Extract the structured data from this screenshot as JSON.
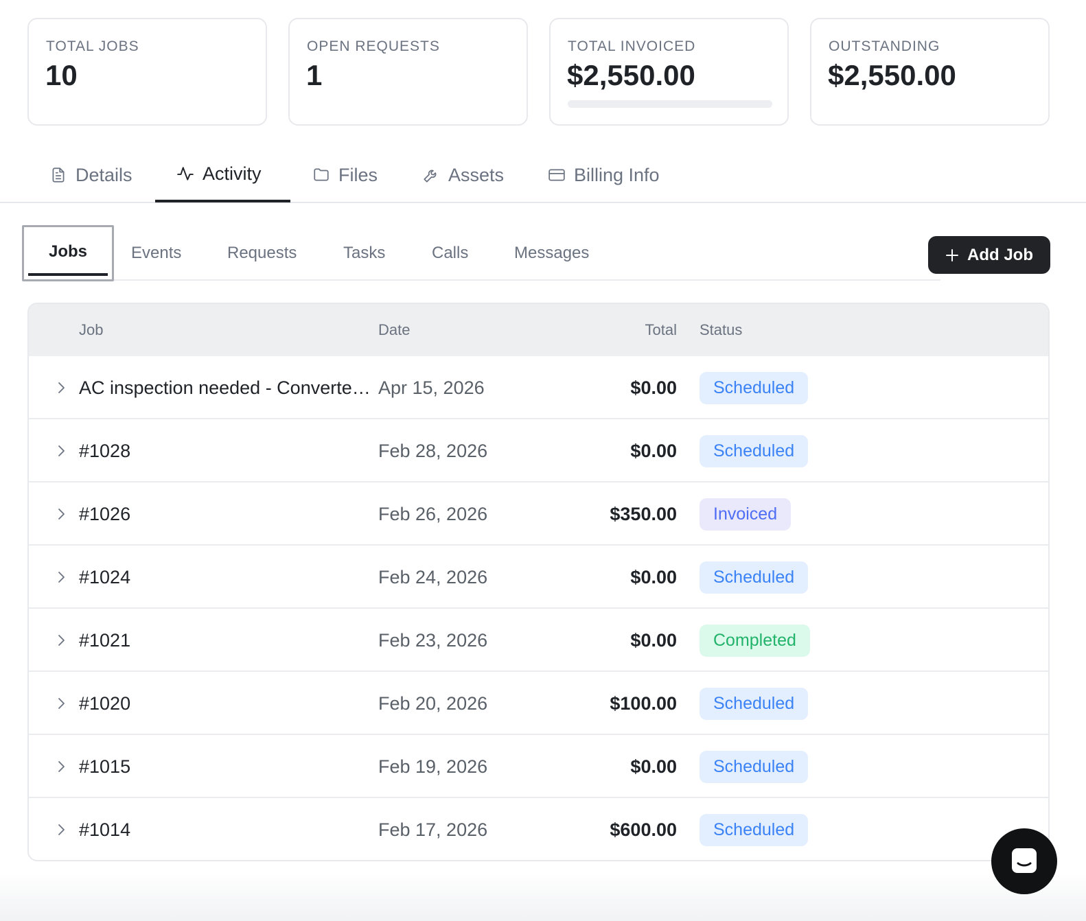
{
  "stats": [
    {
      "label": "TOTAL JOBS",
      "value": "10"
    },
    {
      "label": "OPEN REQUESTS",
      "value": "1"
    },
    {
      "label": "TOTAL INVOICED",
      "value": "$2,550.00",
      "progress_percent": 0
    },
    {
      "label": "OUTSTANDING",
      "value": "$2,550.00"
    }
  ],
  "main_tabs": [
    {
      "label": "Details",
      "icon": "document-icon"
    },
    {
      "label": "Activity",
      "icon": "activity-icon",
      "active": true
    },
    {
      "label": "Files",
      "icon": "folder-icon"
    },
    {
      "label": "Assets",
      "icon": "wrench-icon"
    },
    {
      "label": "Billing Info",
      "icon": "credit-card-icon"
    }
  ],
  "sub_tabs": [
    {
      "label": "Jobs",
      "active": true
    },
    {
      "label": "Events"
    },
    {
      "label": "Requests"
    },
    {
      "label": "Tasks"
    },
    {
      "label": "Calls"
    },
    {
      "label": "Messages"
    }
  ],
  "add_job_label": "Add Job",
  "table": {
    "headers": {
      "job": "Job",
      "date": "Date",
      "total": "Total",
      "status": "Status"
    },
    "rows": [
      {
        "job": "AC inspection needed - Converted from request",
        "date": "Apr 15, 2026",
        "total": "$0.00",
        "status": "Scheduled",
        "status_type": "scheduled"
      },
      {
        "job": "#1028",
        "date": "Feb 28, 2026",
        "total": "$0.00",
        "status": "Scheduled",
        "status_type": "scheduled"
      },
      {
        "job": "#1026",
        "date": "Feb 26, 2026",
        "total": "$350.00",
        "status": "Invoiced",
        "status_type": "invoiced"
      },
      {
        "job": "#1024",
        "date": "Feb 24, 2026",
        "total": "$0.00",
        "status": "Scheduled",
        "status_type": "scheduled"
      },
      {
        "job": "#1021",
        "date": "Feb 23, 2026",
        "total": "$0.00",
        "status": "Completed",
        "status_type": "completed"
      },
      {
        "job": "#1020",
        "date": "Feb 20, 2026",
        "total": "$100.00",
        "status": "Scheduled",
        "status_type": "scheduled"
      },
      {
        "job": "#1015",
        "date": "Feb 19, 2026",
        "total": "$0.00",
        "status": "Scheduled",
        "status_type": "scheduled"
      },
      {
        "job": "#1014",
        "date": "Feb 17, 2026",
        "total": "$600.00",
        "status": "Scheduled",
        "status_type": "scheduled"
      }
    ]
  },
  "colors": {
    "primary_dark": "#212327",
    "scheduled": "#3b82f6",
    "invoiced": "#4f6df5",
    "completed": "#22b36b"
  },
  "chat_icon": "chat-icon"
}
